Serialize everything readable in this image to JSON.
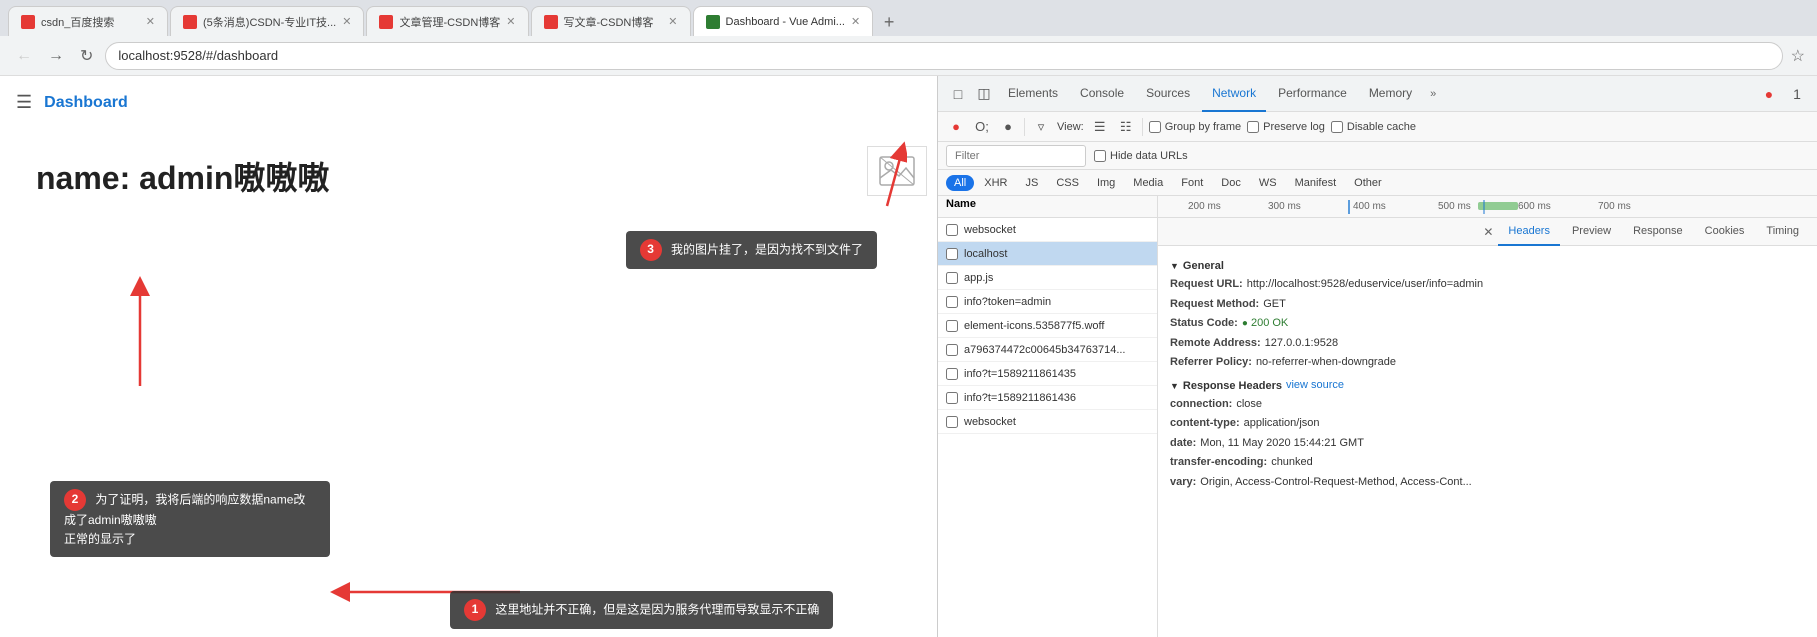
{
  "tabs": [
    {
      "label": "csdn_百度搜索",
      "color": "#e53935",
      "active": false
    },
    {
      "label": "(5条消息)CSDN-专业IT技...",
      "color": "#e53935",
      "active": false
    },
    {
      "label": "文章管理-CSDN博客",
      "color": "#e53935",
      "active": false
    },
    {
      "label": "写文章-CSDN博客",
      "color": "#e53935",
      "active": false
    },
    {
      "label": "Dashboard - Vue Admi...",
      "color": "#2e7d32",
      "active": true
    }
  ],
  "address": "localhost:9528/#/dashboard",
  "page": {
    "title": "Dashboard",
    "name_display": "name: admin嗷嗷嗷"
  },
  "annotations": {
    "annot1": "这里地址并不正确，但是这是因为服务代理而导致显示不正确",
    "annot2_line1": "为了证明，我将后端的响应数据name改成了admin嗷嗷嗷",
    "annot2_line2": "正常的显示了",
    "annot3": "我的图片挂了，是因为找不到文件了"
  },
  "devtools": {
    "tabs": [
      "Elements",
      "Console",
      "Sources",
      "Network",
      "Performance",
      "Memory",
      "»"
    ],
    "active_tab": "Network",
    "toolbar": {
      "view_label": "View:",
      "group_by_frame": "Group by frame",
      "preserve_log": "Preserve log",
      "disable_cache": "Disable cache",
      "filter_placeholder": "Filter",
      "hide_data_urls": "Hide data URLs"
    },
    "filter_types": [
      "All",
      "XHR",
      "JS",
      "CSS",
      "Img",
      "Media",
      "Font",
      "Doc",
      "WS",
      "Manifest",
      "Other"
    ],
    "active_filter": "All",
    "timeline_ticks": [
      "200 ms",
      "300 ms",
      "400 ms",
      "500 ms",
      "600 ms",
      "700 ms"
    ],
    "network_items": [
      {
        "name": "websocket",
        "selected": false
      },
      {
        "name": "localhost",
        "selected": true
      },
      {
        "name": "app.js",
        "selected": false
      },
      {
        "name": "info?token=admin",
        "selected": false
      },
      {
        "name": "element-icons.535877f5.woff",
        "selected": false
      },
      {
        "name": "a796374472c00645b34763714...",
        "selected": false
      },
      {
        "name": "info?t=1589211861435",
        "selected": false
      },
      {
        "name": "info?t=1589211861436",
        "selected": false
      },
      {
        "name": "websocket",
        "selected": false
      }
    ],
    "details": {
      "tabs": [
        "Headers",
        "Preview",
        "Response",
        "Cookies",
        "Timing"
      ],
      "active_tab": "Headers",
      "general": {
        "title": "General",
        "request_url_label": "Request URL:",
        "request_url_val": "http://localhost:9528/eduservice/user/info=admin",
        "request_method_label": "Request Method:",
        "request_method_val": "GET",
        "status_code_label": "Status Code:",
        "status_code_val": "200 OK",
        "remote_addr_label": "Remote Address:",
        "remote_addr_val": "127.0.0.1:9528",
        "referrer_label": "Referrer Policy:",
        "referrer_val": "no-referrer-when-downgrade"
      },
      "response_headers": {
        "title": "Response Headers",
        "view_source": "view source",
        "connection_label": "connection:",
        "connection_val": "close",
        "content_type_label": "content-type:",
        "content_type_val": "application/json",
        "date_label": "date:",
        "date_val": "Mon, 11 May 2020 15:44:21 GMT",
        "transfer_label": "transfer-encoding:",
        "transfer_val": "chunked",
        "vary_label": "vary:",
        "vary_val": "Origin, Access-Control-Request-Method, Access-Cont..."
      }
    }
  }
}
